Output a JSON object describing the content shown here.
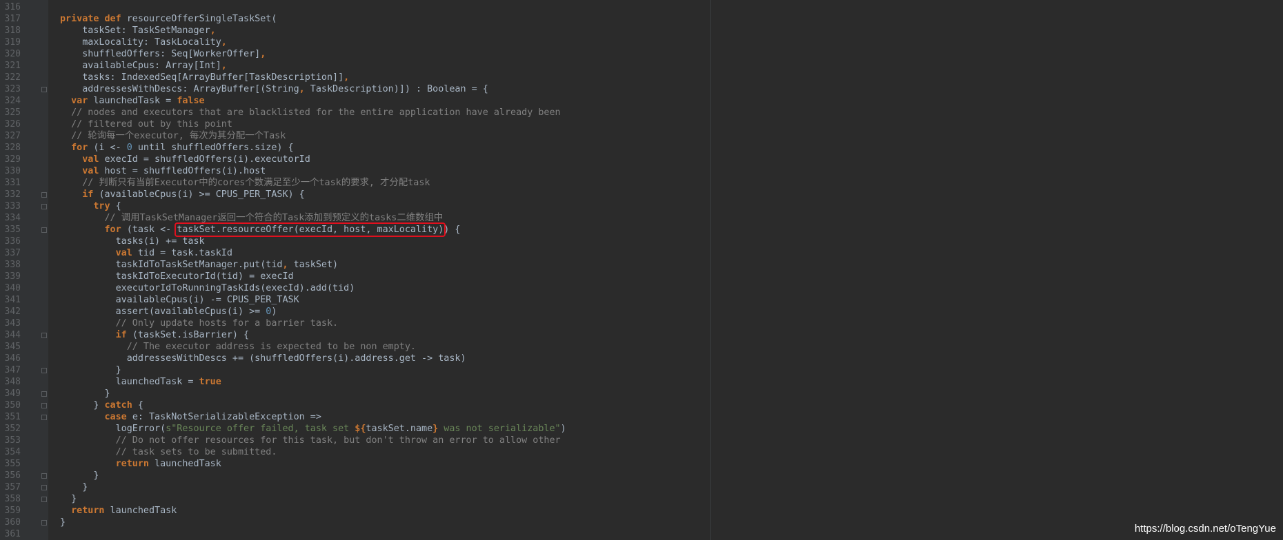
{
  "watermark": "https://blog.csdn.net/oTengYue",
  "lines": [
    {
      "n": "316",
      "segs": []
    },
    {
      "n": "317",
      "segs": [
        {
          "t": "private def ",
          "c": "kw"
        },
        {
          "t": "resourceOfferSingleTaskSet("
        }
      ]
    },
    {
      "n": "318",
      "segs": [
        {
          "t": "    taskSet: TaskSetManager"
        },
        {
          "t": ",",
          "c": "kw"
        }
      ]
    },
    {
      "n": "319",
      "segs": [
        {
          "t": "    maxLocality: TaskLocality"
        },
        {
          "t": ",",
          "c": "kw"
        }
      ]
    },
    {
      "n": "320",
      "segs": [
        {
          "t": "    shuffledOffers: Seq[WorkerOffer]"
        },
        {
          "t": ",",
          "c": "kw"
        }
      ]
    },
    {
      "n": "321",
      "segs": [
        {
          "t": "    availableCpus: Array[Int]"
        },
        {
          "t": ",",
          "c": "kw"
        }
      ]
    },
    {
      "n": "322",
      "segs": [
        {
          "t": "    tasks: IndexedSeq[ArrayBuffer[TaskDescription]]"
        },
        {
          "t": ",",
          "c": "kw"
        }
      ]
    },
    {
      "n": "323",
      "segs": [
        {
          "t": "    addressesWithDescs: ArrayBuffer[(String"
        },
        {
          "t": ", ",
          "c": "kw"
        },
        {
          "t": "TaskDescription)]) : Boolean = {"
        }
      ]
    },
    {
      "n": "324",
      "segs": [
        {
          "t": "  "
        },
        {
          "t": "var ",
          "c": "kw"
        },
        {
          "t": "launchedTask = "
        },
        {
          "t": "false",
          "c": "kw"
        }
      ]
    },
    {
      "n": "325",
      "segs": [
        {
          "t": "  // nodes and executors that are blacklisted for the entire application have already been",
          "c": "cm"
        }
      ]
    },
    {
      "n": "326",
      "segs": [
        {
          "t": "  // filtered out by this point",
          "c": "cm"
        }
      ]
    },
    {
      "n": "327",
      "segs": [
        {
          "t": "  // 轮询每一个executor, 每次为其分配一个Task",
          "c": "cm"
        }
      ]
    },
    {
      "n": "328",
      "segs": [
        {
          "t": "  "
        },
        {
          "t": "for ",
          "c": "kw"
        },
        {
          "t": "(i <- "
        },
        {
          "t": "0",
          "c": "num"
        },
        {
          "t": " until shuffledOffers.size) {"
        }
      ]
    },
    {
      "n": "329",
      "segs": [
        {
          "t": "    "
        },
        {
          "t": "val ",
          "c": "kw"
        },
        {
          "t": "execId = shuffledOffers(i).executorId"
        }
      ]
    },
    {
      "n": "330",
      "segs": [
        {
          "t": "    "
        },
        {
          "t": "val ",
          "c": "kw"
        },
        {
          "t": "host = shuffledOffers(i).host"
        }
      ]
    },
    {
      "n": "331",
      "segs": [
        {
          "t": "    // 判断只有当前Executor中的cores个数满足至少一个task的要求, 才分配task",
          "c": "cm"
        }
      ]
    },
    {
      "n": "332",
      "segs": [
        {
          "t": "    "
        },
        {
          "t": "if ",
          "c": "kw"
        },
        {
          "t": "(availableCpus(i) >= CPUS_PER_TASK) {"
        }
      ]
    },
    {
      "n": "333",
      "segs": [
        {
          "t": "      "
        },
        {
          "t": "try ",
          "c": "kw"
        },
        {
          "t": "{"
        }
      ]
    },
    {
      "n": "334",
      "segs": [
        {
          "t": "        // 调用TaskSetManager返回一个符合的Task添加到预定义的tasks二维数组中",
          "c": "cm"
        }
      ]
    },
    {
      "n": "335",
      "segs": [
        {
          "t": "        "
        },
        {
          "t": "for ",
          "c": "kw"
        },
        {
          "t": "(task <- "
        },
        {
          "t": "taskSet.resourceOffer(execId, host, maxLocality)",
          "c": "hl"
        },
        {
          "t": ") {"
        }
      ]
    },
    {
      "n": "336",
      "segs": [
        {
          "t": "          tasks(i) += task"
        }
      ]
    },
    {
      "n": "337",
      "segs": [
        {
          "t": "          "
        },
        {
          "t": "val ",
          "c": "kw"
        },
        {
          "t": "tid = task.taskId"
        }
      ]
    },
    {
      "n": "338",
      "segs": [
        {
          "t": "          taskIdToTaskSetManager.put(tid"
        },
        {
          "t": ", ",
          "c": "kw"
        },
        {
          "t": "taskSet)"
        }
      ]
    },
    {
      "n": "339",
      "segs": [
        {
          "t": "          taskIdToExecutorId(tid) = execId"
        }
      ]
    },
    {
      "n": "340",
      "segs": [
        {
          "t": "          executorIdToRunningTaskIds(execId).add(tid)"
        }
      ]
    },
    {
      "n": "341",
      "segs": [
        {
          "t": "          availableCpus(i) -= CPUS_PER_TASK"
        }
      ]
    },
    {
      "n": "342",
      "segs": [
        {
          "t": "          assert(availableCpus(i) >= "
        },
        {
          "t": "0",
          "c": "num"
        },
        {
          "t": ")"
        }
      ]
    },
    {
      "n": "343",
      "segs": [
        {
          "t": "          // Only update hosts for a barrier task.",
          "c": "cm"
        }
      ]
    },
    {
      "n": "344",
      "segs": [
        {
          "t": "          "
        },
        {
          "t": "if ",
          "c": "kw"
        },
        {
          "t": "(taskSet.isBarrier) {"
        }
      ]
    },
    {
      "n": "345",
      "segs": [
        {
          "t": "            // The executor address is expected to be non empty.",
          "c": "cm"
        }
      ]
    },
    {
      "n": "346",
      "segs": [
        {
          "t": "            addressesWithDescs += (shuffledOffers(i).address.get -> task)"
        }
      ]
    },
    {
      "n": "347",
      "segs": [
        {
          "t": "          }"
        }
      ]
    },
    {
      "n": "348",
      "segs": [
        {
          "t": "          launchedTask = "
        },
        {
          "t": "true",
          "c": "kw"
        }
      ]
    },
    {
      "n": "349",
      "segs": [
        {
          "t": "        }"
        }
      ]
    },
    {
      "n": "350",
      "segs": [
        {
          "t": "      } "
        },
        {
          "t": "catch ",
          "c": "kw"
        },
        {
          "t": "{"
        }
      ]
    },
    {
      "n": "351",
      "segs": [
        {
          "t": "        "
        },
        {
          "t": "case ",
          "c": "kw"
        },
        {
          "t": "e: TaskNotSerializableException =>"
        }
      ]
    },
    {
      "n": "352",
      "segs": [
        {
          "t": "          logError("
        },
        {
          "t": "s\"Resource offer failed, task set ",
          "c": "str"
        },
        {
          "t": "${",
          "c": "kw"
        },
        {
          "t": "taskSet.name"
        },
        {
          "t": "}",
          "c": "kw"
        },
        {
          "t": " was not serializable\"",
          "c": "str"
        },
        {
          "t": ")"
        }
      ]
    },
    {
      "n": "353",
      "segs": [
        {
          "t": "          // Do not offer resources for this task, but don't throw an error to allow other",
          "c": "cm"
        }
      ]
    },
    {
      "n": "354",
      "segs": [
        {
          "t": "          // task sets to be submitted.",
          "c": "cm"
        }
      ]
    },
    {
      "n": "355",
      "segs": [
        {
          "t": "          "
        },
        {
          "t": "return ",
          "c": "kw"
        },
        {
          "t": "launchedTask"
        }
      ]
    },
    {
      "n": "356",
      "segs": [
        {
          "t": "      }"
        }
      ]
    },
    {
      "n": "357",
      "segs": [
        {
          "t": "    }"
        }
      ]
    },
    {
      "n": "358",
      "segs": [
        {
          "t": "  }"
        }
      ]
    },
    {
      "n": "359",
      "segs": [
        {
          "t": "  "
        },
        {
          "t": "return ",
          "c": "kw"
        },
        {
          "t": "launchedTask"
        }
      ]
    },
    {
      "n": "360",
      "segs": [
        {
          "t": "}"
        }
      ]
    },
    {
      "n": "361",
      "segs": []
    }
  ]
}
